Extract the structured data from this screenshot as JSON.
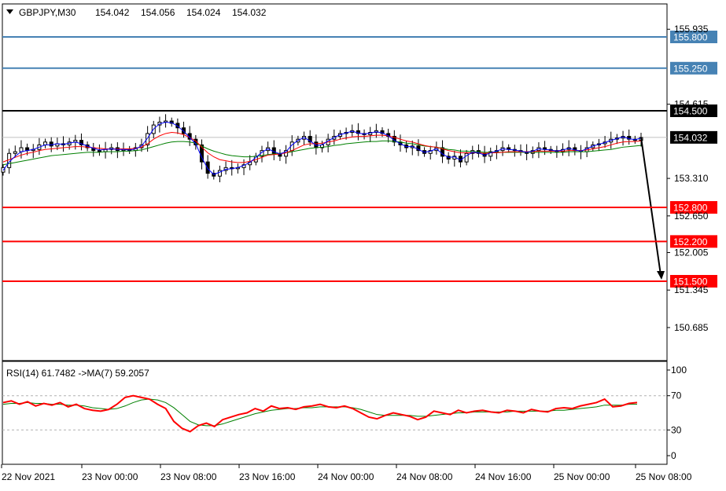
{
  "header": {
    "menu_icon": "triangle-down-icon",
    "symbol": "GBPJPY,M30",
    "open": "154.042",
    "high": "154.056",
    "low": "154.024",
    "close": "154.032"
  },
  "rsi_header": {
    "text": "RSI(14) 61.7482  ->MA(7) 59.2057"
  },
  "colors": {
    "background": "#ffffff",
    "resistance": "#4682b4",
    "pivot": "#000000",
    "support": "#ff0000",
    "ma_fast": "#0000ff",
    "ma_mid": "#ff0000",
    "ma_slow": "#008000",
    "rsi": "#ff0000",
    "rsi_ma": "#008000",
    "forecast_arrow": "#000000"
  },
  "chart_data": [
    {
      "type": "candlestick",
      "symbol": "GBPJPY",
      "timeframe": "M30",
      "ylim": [
        150.5,
        156.0
      ],
      "y_ticks": [
        "155.935",
        "154.615",
        "153.310",
        "152.650",
        "152.005",
        "151.345",
        "150.685"
      ],
      "x_ticks": [
        "22 Nov 2021",
        "23 Nov 00:00",
        "23 Nov 08:00",
        "23 Nov 16:00",
        "24 Nov 00:00",
        "24 Nov 08:00",
        "24 Nov 16:00",
        "25 Nov 00:00",
        "25 Nov 08:00"
      ],
      "current_price": "154.032",
      "levels": [
        {
          "value": 155.8,
          "label": "155.800",
          "kind": "resistance"
        },
        {
          "value": 155.25,
          "label": "155.250",
          "kind": "resistance"
        },
        {
          "value": 154.5,
          "label": "154.500",
          "kind": "pivot"
        },
        {
          "value": 152.8,
          "label": "152.800",
          "kind": "support"
        },
        {
          "value": 152.2,
          "label": "152.200",
          "kind": "support"
        },
        {
          "value": 151.5,
          "label": "151.500",
          "kind": "support"
        }
      ],
      "close_series": [
        153.5,
        153.75,
        153.78,
        153.85,
        153.8,
        153.82,
        153.9,
        153.95,
        153.88,
        153.92,
        153.9,
        153.95,
        153.98,
        153.9,
        153.85,
        153.8,
        153.78,
        153.82,
        153.85,
        153.8,
        153.82,
        153.8,
        153.85,
        153.9,
        154.1,
        154.25,
        154.3,
        154.32,
        154.28,
        154.2,
        154.1,
        154.0,
        153.9,
        153.6,
        153.4,
        153.35,
        153.45,
        153.5,
        153.48,
        153.5,
        153.55,
        153.6,
        153.7,
        153.8,
        153.85,
        153.75,
        153.7,
        153.8,
        153.95,
        154.0,
        154.05,
        153.95,
        153.85,
        153.9,
        154.0,
        154.05,
        154.1,
        154.12,
        154.15,
        154.1,
        154.08,
        154.12,
        154.15,
        154.1,
        154.05,
        153.95,
        153.9,
        153.85,
        153.88,
        153.8,
        153.75,
        153.8,
        153.85,
        153.7,
        153.65,
        153.7,
        153.6,
        153.75,
        153.8,
        153.75,
        153.7,
        153.78,
        153.8,
        153.85,
        153.82,
        153.8,
        153.78,
        153.75,
        153.8,
        153.85,
        153.82,
        153.8,
        153.78,
        153.82,
        153.85,
        153.8,
        153.78,
        153.85,
        153.9,
        153.92,
        153.95,
        154.0,
        154.02,
        154.05,
        154.0,
        153.98,
        154.03
      ],
      "ma_fast_series": [
        153.45,
        153.6,
        153.7,
        153.78,
        153.8,
        153.82,
        153.86,
        153.9,
        153.9,
        153.92,
        153.91,
        153.93,
        153.95,
        153.92,
        153.88,
        153.84,
        153.81,
        153.82,
        153.83,
        153.82,
        153.82,
        153.81,
        153.83,
        153.88,
        154.02,
        154.18,
        154.27,
        154.3,
        154.29,
        154.23,
        154.14,
        154.03,
        153.92,
        153.68,
        153.48,
        153.38,
        153.42,
        153.47,
        153.48,
        153.5,
        153.54,
        153.59,
        153.68,
        153.77,
        153.83,
        153.78,
        153.74,
        153.78,
        153.9,
        153.98,
        154.03,
        153.97,
        153.89,
        153.9,
        153.97,
        154.03,
        154.08,
        154.11,
        154.14,
        154.11,
        154.09,
        154.11,
        154.13,
        154.11,
        154.06,
        153.98,
        153.92,
        153.87,
        153.87,
        153.82,
        153.77,
        153.79,
        153.83,
        153.74,
        153.68,
        153.69,
        153.63,
        153.71,
        153.77,
        153.76,
        153.72,
        153.76,
        153.79,
        153.83,
        153.82,
        153.81,
        153.79,
        153.77,
        153.79,
        153.83,
        153.82,
        153.81,
        153.79,
        153.81,
        153.84,
        153.81,
        153.79,
        153.83,
        153.88,
        153.91,
        153.94,
        153.98,
        154.01,
        154.04,
        154.01,
        153.99,
        154.02
      ],
      "ma_mid_series": [
        153.6,
        153.64,
        153.68,
        153.72,
        153.75,
        153.77,
        153.8,
        153.82,
        153.83,
        153.84,
        153.85,
        153.86,
        153.87,
        153.87,
        153.86,
        153.85,
        153.84,
        153.83,
        153.83,
        153.83,
        153.83,
        153.83,
        153.84,
        153.86,
        153.92,
        154.0,
        154.06,
        154.1,
        154.12,
        154.11,
        154.08,
        154.03,
        153.97,
        153.86,
        153.76,
        153.69,
        153.64,
        153.62,
        153.6,
        153.59,
        153.59,
        153.61,
        153.64,
        153.68,
        153.72,
        153.73,
        153.74,
        153.76,
        153.8,
        153.85,
        153.9,
        153.92,
        153.92,
        153.93,
        153.95,
        153.97,
        154.0,
        154.02,
        154.04,
        154.05,
        154.05,
        154.06,
        154.07,
        154.07,
        154.06,
        154.03,
        154.0,
        153.97,
        153.95,
        153.92,
        153.89,
        153.87,
        153.86,
        153.83,
        153.8,
        153.78,
        153.76,
        153.76,
        153.76,
        153.76,
        153.75,
        153.76,
        153.76,
        153.77,
        153.78,
        153.78,
        153.78,
        153.78,
        153.78,
        153.79,
        153.79,
        153.79,
        153.79,
        153.79,
        153.8,
        153.8,
        153.8,
        153.81,
        153.83,
        153.85,
        153.87,
        153.9,
        153.93,
        153.95,
        153.96,
        153.96,
        153.97
      ],
      "ma_slow_series": [
        153.55,
        153.57,
        153.59,
        153.61,
        153.63,
        153.65,
        153.67,
        153.69,
        153.71,
        153.72,
        153.73,
        153.74,
        153.75,
        153.76,
        153.77,
        153.77,
        153.77,
        153.78,
        153.78,
        153.78,
        153.79,
        153.79,
        153.8,
        153.81,
        153.84,
        153.87,
        153.9,
        153.93,
        153.95,
        153.96,
        153.96,
        153.95,
        153.93,
        153.88,
        153.83,
        153.79,
        153.76,
        153.73,
        153.71,
        153.7,
        153.69,
        153.69,
        153.7,
        153.71,
        153.73,
        153.74,
        153.75,
        153.76,
        153.78,
        153.8,
        153.82,
        153.84,
        153.85,
        153.86,
        153.87,
        153.89,
        153.9,
        153.92,
        153.93,
        153.94,
        153.95,
        153.96,
        153.96,
        153.97,
        153.97,
        153.96,
        153.95,
        153.93,
        153.92,
        153.9,
        153.88,
        153.87,
        153.86,
        153.84,
        153.82,
        153.81,
        153.79,
        153.79,
        153.78,
        153.78,
        153.77,
        153.77,
        153.77,
        153.77,
        153.77,
        153.77,
        153.77,
        153.77,
        153.77,
        153.77,
        153.77,
        153.77,
        153.77,
        153.77,
        153.78,
        153.78,
        153.78,
        153.78,
        153.79,
        153.8,
        153.81,
        153.82,
        153.84,
        153.86,
        153.87,
        153.88,
        153.89
      ]
    },
    {
      "type": "line",
      "indicator": "RSI(14)",
      "ylim": [
        0,
        100
      ],
      "y_ticks": [
        "100",
        "70",
        "30",
        "0"
      ],
      "guide_levels": [
        70,
        30
      ],
      "rsi_value": "61.7482",
      "ma_value": "59.2057",
      "rsi_series": [
        62,
        64,
        60,
        63,
        58,
        61,
        59,
        62,
        57,
        60,
        55,
        53,
        52,
        54,
        60,
        68,
        70,
        68,
        66,
        60,
        55,
        40,
        32,
        28,
        35,
        38,
        34,
        42,
        45,
        48,
        50,
        55,
        52,
        58,
        55,
        56,
        54,
        57,
        58,
        60,
        57,
        56,
        58,
        55,
        50,
        45,
        43,
        47,
        50,
        48,
        46,
        42,
        45,
        52,
        50,
        48,
        53,
        50,
        52,
        53,
        51,
        50,
        53,
        52,
        50,
        54,
        52,
        51,
        55,
        56,
        55,
        58,
        60,
        62,
        66,
        57,
        58,
        61,
        62
      ],
      "rsi_ma_series": [
        60,
        61,
        61,
        62,
        61,
        61,
        60,
        60,
        59,
        59,
        58,
        56,
        55,
        54,
        55,
        58,
        62,
        65,
        66,
        65,
        62,
        56,
        48,
        40,
        36,
        35,
        35,
        37,
        40,
        43,
        46,
        49,
        51,
        53,
        54,
        55,
        55,
        56,
        56,
        57,
        57,
        57,
        57,
        56,
        54,
        51,
        48,
        47,
        47,
        47,
        47,
        46,
        46,
        47,
        48,
        49,
        50,
        50,
        51,
        51,
        51,
        51,
        51,
        52,
        52,
        52,
        52,
        52,
        53,
        53,
        54,
        55,
        56,
        57,
        59,
        59,
        59,
        60,
        60
      ]
    }
  ]
}
